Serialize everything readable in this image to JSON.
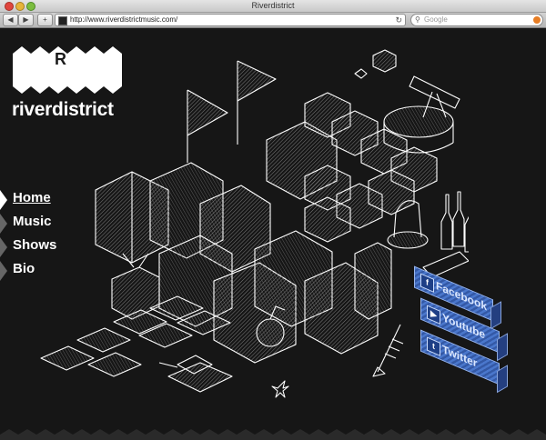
{
  "browser": {
    "title": "Riverdistrict",
    "url": "http://www.riverdistrictmusic.com/",
    "search_placeholder": "Google",
    "buttons": {
      "back": "◀",
      "forward": "▶",
      "add": "+",
      "reload": "↻"
    }
  },
  "logo": {
    "letter": "R",
    "wordmark": "riverdistrict"
  },
  "nav": [
    {
      "label": "Home",
      "active": true
    },
    {
      "label": "Music",
      "active": false
    },
    {
      "label": "Shows",
      "active": false
    },
    {
      "label": "Bio",
      "active": false
    }
  ],
  "social": [
    {
      "label": "Facebook",
      "icon": "facebook-icon",
      "glyph": "f"
    },
    {
      "label": "Youtube",
      "icon": "youtube-icon",
      "glyph": "▶"
    },
    {
      "label": "Twitter",
      "icon": "twitter-icon",
      "glyph": "t"
    }
  ],
  "colors": {
    "background": "#161616",
    "social_blue": "#3a63b5",
    "text": "#ffffff"
  }
}
